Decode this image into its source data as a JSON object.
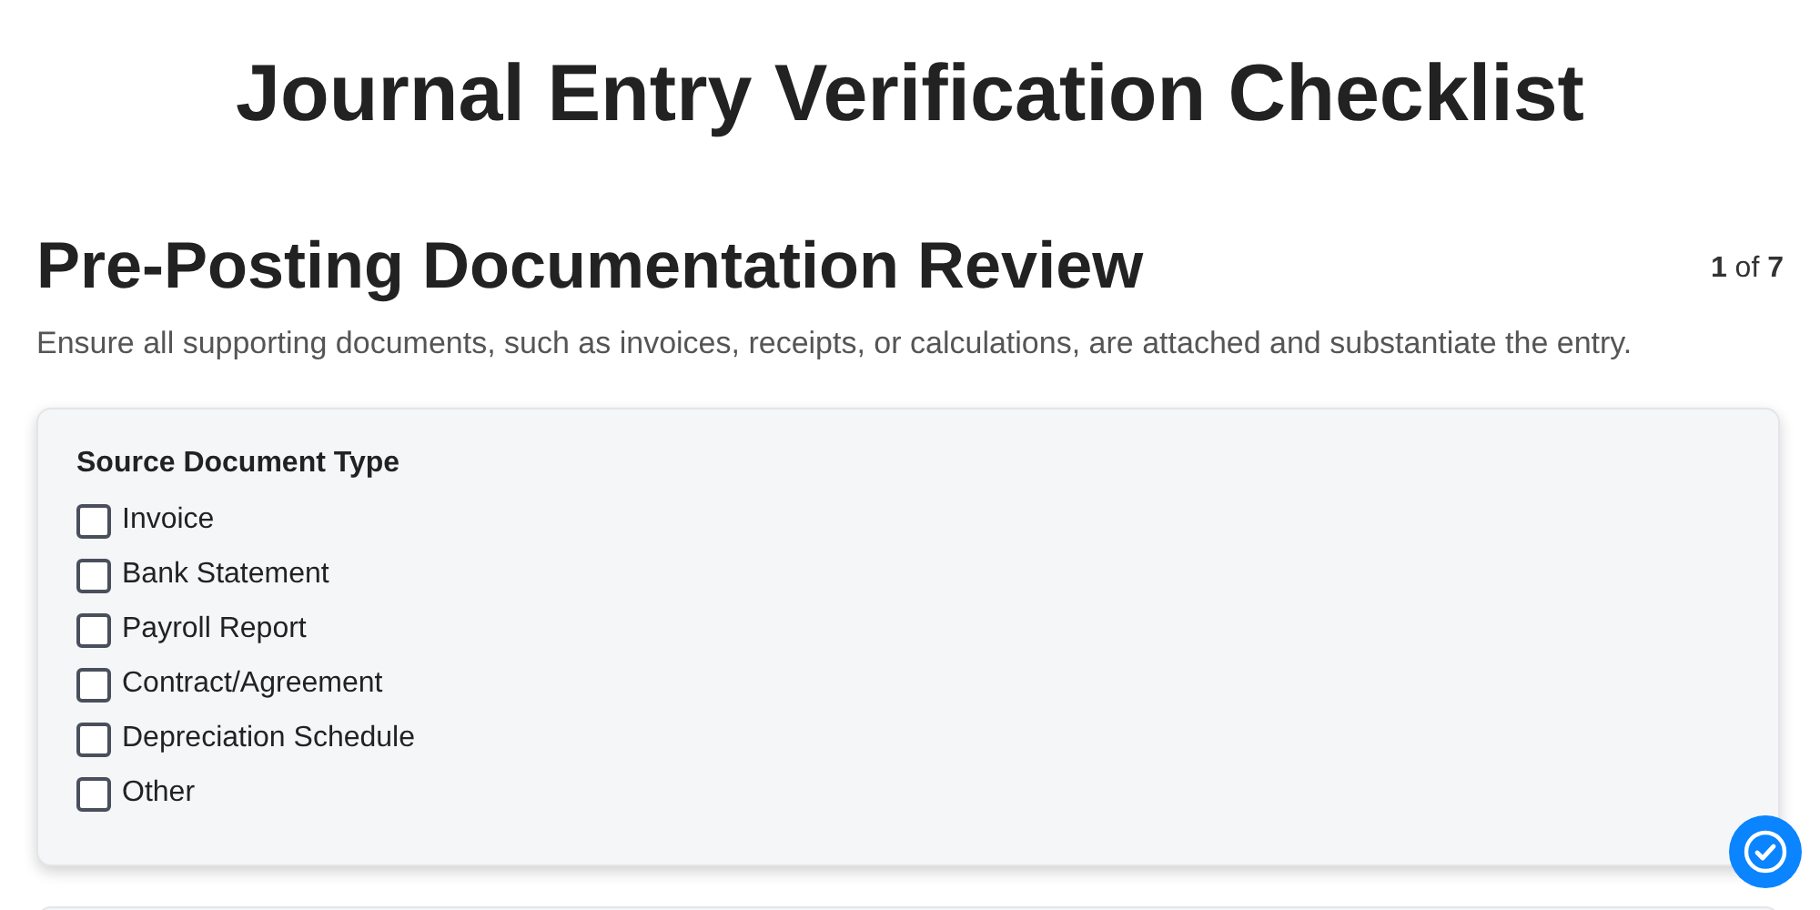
{
  "title": "Journal Entry Verification Checklist",
  "section": {
    "heading": "Pre-Posting Documentation Review",
    "counter": "**1** of **7**",
    "description": "Ensure all supporting documents, such as invoices, receipts, or calculations, are attached and substantiate the entry."
  },
  "group": {
    "label": "Source Document Type",
    "options": [
      {
        "label": "Invoice",
        "checked": false
      },
      {
        "label": "Bank Statement",
        "checked": false
      },
      {
        "label": "Payroll Report",
        "checked": false
      },
      {
        "label": "Contract/Agreement",
        "checked": false
      },
      {
        "label": "Depreciation Schedule",
        "checked": false
      },
      {
        "label": "Other",
        "checked": false
      }
    ]
  }
}
